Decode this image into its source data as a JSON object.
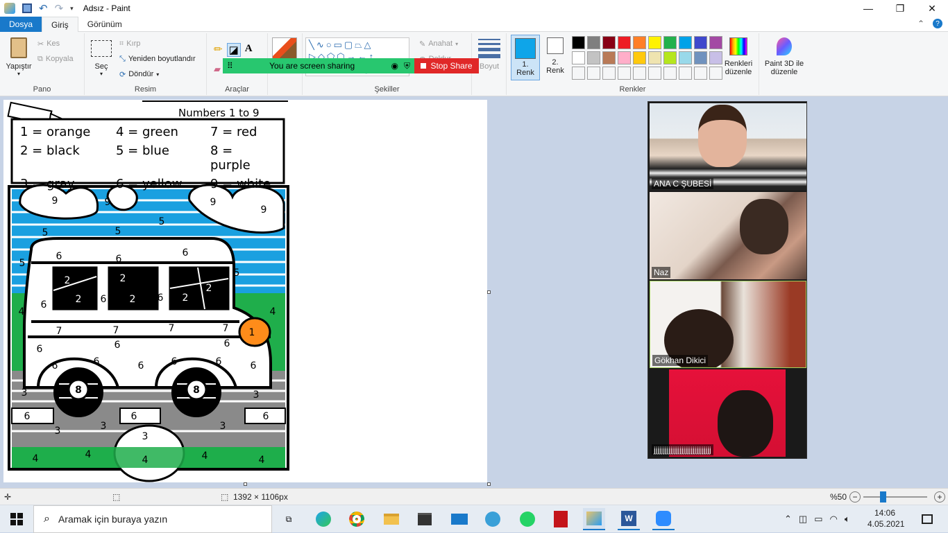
{
  "window": {
    "title": "Adsız - Paint"
  },
  "tabs": {
    "file": "Dosya",
    "home": "Giriş",
    "view": "Görünüm"
  },
  "clipboard": {
    "paste": "Yapıştır",
    "cut": "Kes",
    "copy": "Kopyala",
    "group": "Pano"
  },
  "image": {
    "select": "Seç",
    "crop": "Kırp",
    "resize": "Yeniden boyutlandır",
    "rotate": "Döndür",
    "group": "Resim"
  },
  "tools": {
    "group": "Araçlar"
  },
  "shapes": {
    "outline": "Anahat",
    "fill": "Doldur",
    "group": "Şekiller",
    "size": "Boyut"
  },
  "colors": {
    "color1": "1.\nRenk",
    "color2": "2.\nRenk",
    "edit": "Renkleri\ndüzenle",
    "paint3d": "Paint 3D ile\ndüzenle",
    "group": "Renkler",
    "color1_value": "#0ea5e9",
    "palette_row1": [
      "#000000",
      "#7f7f7f",
      "#880015",
      "#ed1c24",
      "#ff7f27",
      "#fff200",
      "#22b14c",
      "#00a2e8",
      "#3f48cc",
      "#a349a4"
    ],
    "palette_row2": [
      "#ffffff",
      "#c3c3c3",
      "#b97a57",
      "#ffaec9",
      "#ffc90e",
      "#efe4b0",
      "#b5e61d",
      "#99d9ea",
      "#7092be",
      "#c8bfe7"
    ]
  },
  "share": {
    "status": "You are screen sharing",
    "stop": "Stop Share"
  },
  "worksheet": {
    "subtitle": "Numbers 1 to 9",
    "key": [
      "1 = orange",
      "4 = green",
      "7 = red",
      "2 = black",
      "5 = blue",
      "8 = purple",
      "3 = gray",
      "6 = yellow",
      "9 = white"
    ]
  },
  "participants": [
    {
      "name": "ANA C ŞUBESİ"
    },
    {
      "name": "Naz"
    },
    {
      "name": "Gökhan Dikici"
    },
    {
      "name": "jjjjjjjjjjjjjjjjjjjjjjjjjjjjjjj"
    }
  ],
  "status": {
    "size": "1392 × 1106px",
    "zoom": "%50",
    "zoom_level": 0.5
  },
  "taskbar": {
    "search": "Aramak için buraya yazın",
    "time": "14:06",
    "date": "4.05.2021"
  }
}
